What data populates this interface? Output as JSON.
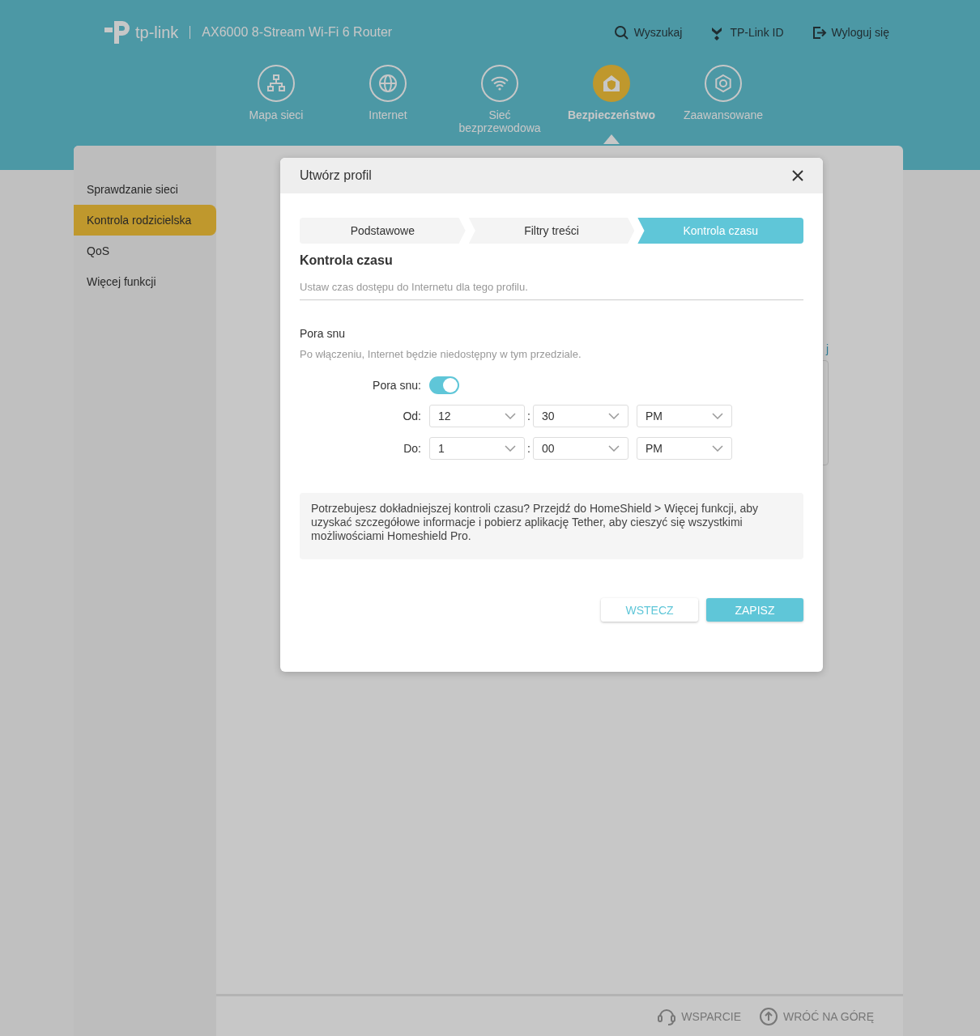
{
  "header": {
    "logo": "tp-link",
    "product": "AX6000 8-Stream Wi-Fi 6 Router",
    "top_links": [
      {
        "label": "Wyszukaj",
        "kind": "search"
      },
      {
        "label": "TP-Link ID",
        "kind": "account"
      },
      {
        "label": "Wyloguj się",
        "kind": "logout"
      }
    ],
    "nav": [
      {
        "label": "Mapa sieci",
        "kind": "network",
        "selected": false
      },
      {
        "label": "Internet",
        "kind": "globe",
        "selected": false
      },
      {
        "label": "Sieć bezprzewodowa",
        "kind": "wifi",
        "selected": false
      },
      {
        "label": "Bezpieczeństwo",
        "kind": "shield",
        "selected": true
      },
      {
        "label": "Zaawansowane",
        "kind": "gear",
        "selected": false
      }
    ]
  },
  "sidebar": {
    "items": [
      {
        "label": "Sprawdzanie sieci",
        "selected": false
      },
      {
        "label": "Kontrola rodzicielska",
        "selected": true
      },
      {
        "label": "QoS",
        "selected": false
      },
      {
        "label": "Więcej funkcji",
        "selected": false
      }
    ]
  },
  "content": {
    "link_fragment": "j"
  },
  "footer": {
    "links": [
      {
        "label": "WSPARCIE",
        "kind": "support"
      },
      {
        "label": "WRÓĆ NA GÓRĘ",
        "kind": "top"
      }
    ]
  },
  "modal": {
    "title": "Utwórz profil",
    "steps": [
      {
        "label": "Podstawowe",
        "selected": false
      },
      {
        "label": "Filtry treści",
        "selected": false
      },
      {
        "label": "Kontrola czasu",
        "selected": true
      }
    ],
    "section_title": "Kontrola czasu",
    "section_description": "Ustaw czas dostępu do Internetu dla tego profilu.",
    "sleep_time": {
      "title": "Pora snu",
      "description": "Po włączeniu, Internet będzie niedostępny w tym przedziale.",
      "toggle": {
        "label": "Pora snu:",
        "on": true
      },
      "rows": [
        {
          "label": "Od:",
          "hour": "12",
          "separator": ":",
          "minute": "30",
          "period": "PM"
        },
        {
          "label": "Do:",
          "hour": "1",
          "separator": ":",
          "minute": "00",
          "period": "PM"
        }
      ]
    },
    "info": "Potrzebujesz dokładniejszej kontroli czasu? Przejdź do HomeShield > Więcej funkcji, aby uzyskać szczegółowe informacje i pobierz aplikację Tether, aby cieszyć się wszystkimi możliwościami Homeshield Pro.",
    "buttons": [
      {
        "label": "WSTECZ",
        "kind": "secondary"
      },
      {
        "label": "ZAPISZ",
        "kind": "primary"
      }
    ]
  }
}
